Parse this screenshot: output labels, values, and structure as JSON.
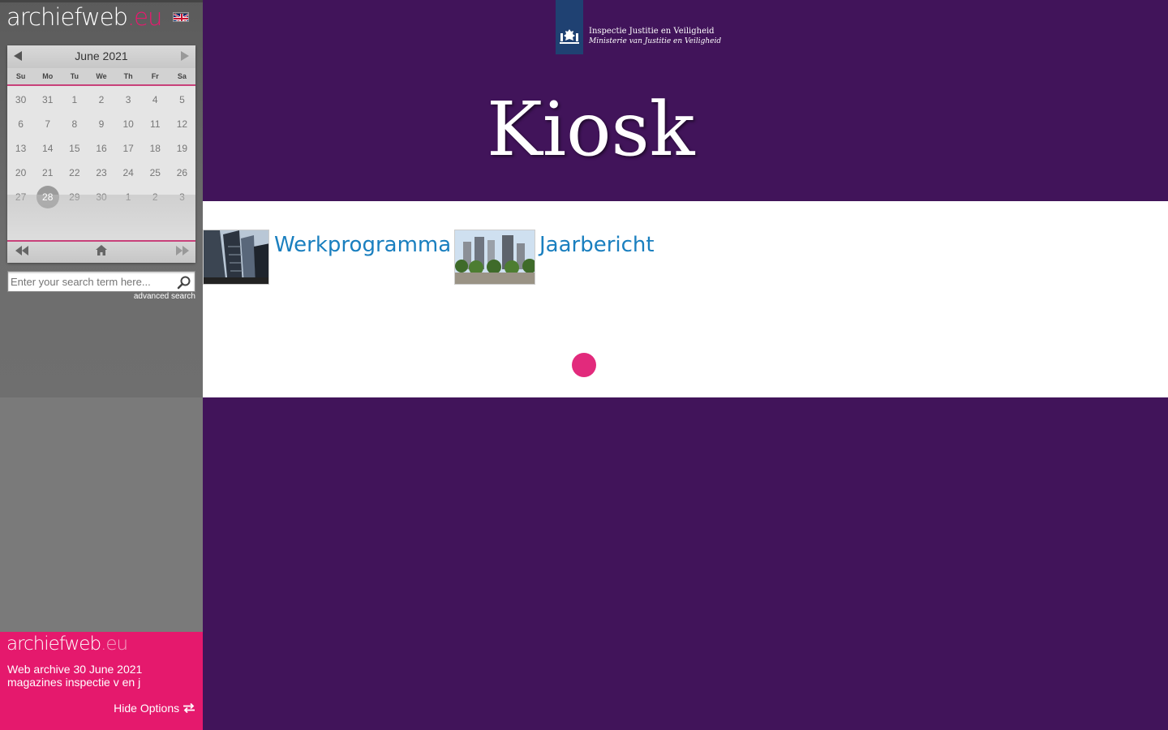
{
  "sidebar": {
    "logo": {
      "name": "archiefweb",
      "tld": ".eu"
    },
    "calendar": {
      "title": "June 2021",
      "days_of_week": [
        "Su",
        "Mo",
        "Tu",
        "We",
        "Th",
        "Fr",
        "Sa"
      ],
      "weeks": [
        [
          "30",
          "31",
          "1",
          "2",
          "3",
          "4",
          "5"
        ],
        [
          "6",
          "7",
          "8",
          "9",
          "10",
          "11",
          "12"
        ],
        [
          "13",
          "14",
          "15",
          "16",
          "17",
          "18",
          "19"
        ],
        [
          "20",
          "21",
          "22",
          "23",
          "24",
          "25",
          "26"
        ],
        [
          "27",
          "28",
          "29",
          "30",
          "1",
          "2",
          "3"
        ]
      ],
      "selected_day": "28"
    },
    "search": {
      "placeholder": "Enter your search term here...",
      "advanced_label": "advanced search"
    },
    "promo": {
      "logo": {
        "name": "archiefweb",
        "tld": ".eu"
      },
      "line1": "Web archive 30 June 2021",
      "line2": "magazines inspectie v en j",
      "hide_label": "Hide Options"
    }
  },
  "header": {
    "org_line1": "Inspectie Justitie en Veiligheid",
    "org_line2": "Ministerie van Justitie en Veiligheid",
    "title": "Kiosk"
  },
  "magazines": [
    {
      "label": "Werkprogramma"
    },
    {
      "label": "Jaarbericht"
    }
  ],
  "colors": {
    "header_bg": "#41145a",
    "accent_pink": "#e5196d",
    "link_blue": "#1a7fbf",
    "gov_blue": "#1f4172"
  }
}
